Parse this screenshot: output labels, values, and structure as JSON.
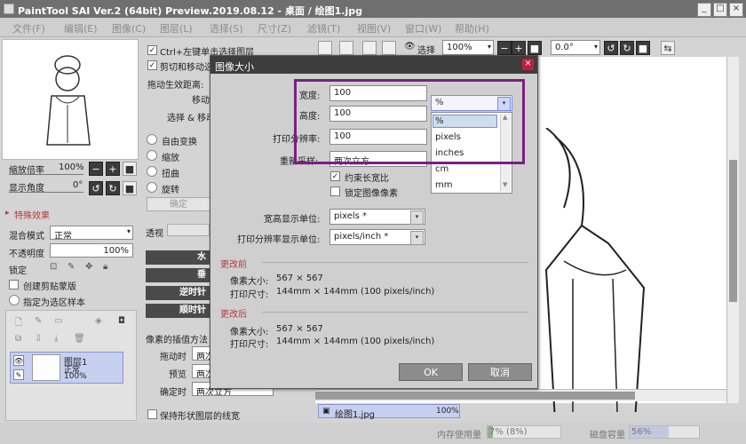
{
  "app": {
    "title": "PaintTool SAI Ver.2 (64bit) Preview.2019.08.12 - 桌面 / 绘图1.jpg"
  },
  "window": {
    "min": "_",
    "max": "□",
    "close": "×"
  },
  "menus": [
    "文件(F)",
    "编辑(E)",
    "图像(C)",
    "图层(L)",
    "选择(S)",
    "尺寸(Z)",
    "滤镜(T)",
    "视图(V)",
    "窗口(W)",
    "帮助(H)"
  ],
  "navigator": {
    "zoom_label": "缩放倍率",
    "zoom_value": "100%",
    "angle_label": "显示角度",
    "angle_value": "0°"
  },
  "special_effects": {
    "header": "特殊效果"
  },
  "layer_props": {
    "blend_label": "混合模式",
    "blend_value": "正常",
    "opacity_label": "不透明度",
    "opacity_value": "100%",
    "lock_label": "锁定",
    "clip_label": "创建剪贴蒙版",
    "sample_label": "指定为选区样本"
  },
  "layer": {
    "name": "图层1",
    "mode": "正常",
    "opacity": "100%"
  },
  "transform": {
    "opt1": "Ctrl+左键单击选择图层",
    "opt2": "剪切和移动选",
    "drag_label": "拖动生效距离:",
    "move_label": "移动",
    "select_move_label": "选择 & 移动",
    "free": "自由变换",
    "scale": "缩放",
    "distort": "扭曲",
    "rotate": "旋转",
    "confirm": "确定",
    "perspective_label": "透视"
  },
  "dark_buttons": [
    "水",
    "垂",
    "逆时针",
    "顺时针"
  ],
  "interp": {
    "header": "像素的插值方法",
    "drag_label": "拖动时",
    "drag_value": "两次",
    "preview_label": "预览",
    "preview_value": "两次",
    "confirm_label": "确定时",
    "confirm_value": "两次立方"
  },
  "keep_layer": "保持形状图层的线宽",
  "toolbar": {
    "select_label": "选择",
    "zoom": "100%",
    "angle": "0.0°"
  },
  "dialog": {
    "title": "图像大小",
    "width_label": "宽度:",
    "width_value": "100",
    "height_label": "高度:",
    "height_value": "100",
    "unit_selected": "%",
    "unit_options": [
      "%",
      "pixels",
      "inches",
      "cm",
      "mm"
    ],
    "dpi_label": "打印分辨率:",
    "dpi_value": "100",
    "resample_label": "重新采样:",
    "resample_value": "两次立方",
    "constrain_label": "约束长宽比",
    "lock_pixels_label": "锁定图像像素",
    "size_unit_label": "宽高显示单位:",
    "size_unit_value": "pixels *",
    "dpi_unit_label": "打印分辨率显示单位:",
    "dpi_unit_value": "pixels/inch *",
    "before_header": "更改前",
    "before_pixels_label": "像素大小:",
    "before_pixels": "567 × 567",
    "before_print_label": "打印尺寸:",
    "before_print": "144mm × 144mm (100 pixels/inch)",
    "after_header": "更改后",
    "after_pixels_label": "像素大小:",
    "after_pixels": "567 × 567",
    "after_print_label": "打印尺寸:",
    "after_print": "144mm × 144mm (100 pixels/inch)",
    "ok": "OK",
    "cancel": "取消"
  },
  "doc_tab": {
    "name": "绘图1.jpg",
    "zoom": "100%"
  },
  "status": {
    "mem_label": "内存使用量",
    "mem_value": "7% (8%)",
    "disk_label": "磁盘容量",
    "disk_value": "56%"
  }
}
